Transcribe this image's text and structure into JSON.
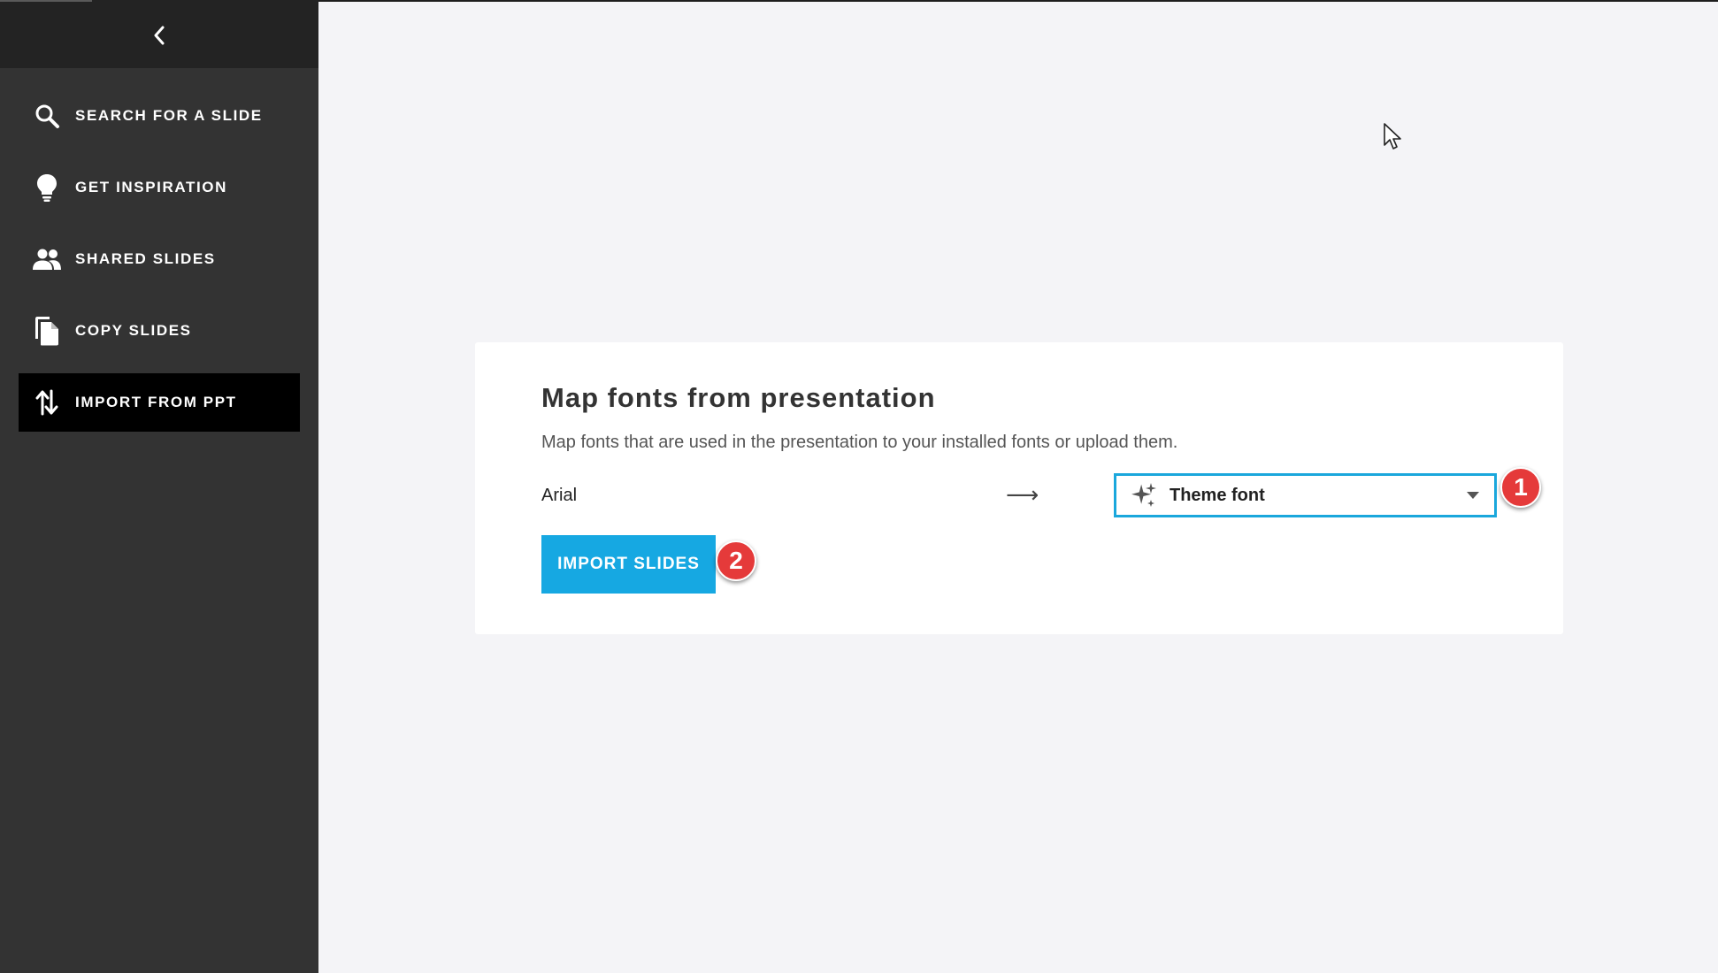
{
  "sidebar": {
    "items": [
      {
        "label": "SEARCH FOR A SLIDE",
        "icon": "search-icon",
        "active": false
      },
      {
        "label": "GET INSPIRATION",
        "icon": "lightbulb-icon",
        "active": false
      },
      {
        "label": "SHARED SLIDES",
        "icon": "people-icon",
        "active": false
      },
      {
        "label": "COPY SLIDES",
        "icon": "copy-icon",
        "active": false
      },
      {
        "label": "IMPORT FROM PPT",
        "icon": "import-arrows-icon",
        "active": true
      }
    ]
  },
  "dialog": {
    "title": "Map fonts from presentation",
    "description": "Map fonts that are used in the presentation to your installed fonts or upload them.",
    "mapping": {
      "source_font": "Arial",
      "arrow": "⟶",
      "target_font": "Theme font"
    },
    "import_button": "IMPORT SLIDES"
  },
  "annotations": {
    "step1": "1",
    "step2": "2"
  },
  "colors": {
    "sidebar_bg": "#333333",
    "accent": "#16a8e2",
    "badge": "#e53a3a"
  }
}
